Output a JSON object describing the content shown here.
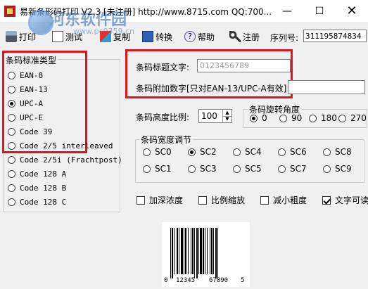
{
  "window": {
    "title": "易新条形码打印 V2.3 [未注册]  http://www.8715.com QQ:700..."
  },
  "watermark": {
    "title": "河东软件园",
    "url": "www.pc0359.cn"
  },
  "toolbar": {
    "print": "打印",
    "test": "测试",
    "copy": "复制",
    "convert": "转换",
    "help": "帮助",
    "register": "注册",
    "serial_label": "序列号:",
    "serial_value": "311195874834"
  },
  "standard_group": {
    "legend": "条码标准类型",
    "options": [
      "EAN-8",
      "EAN-13",
      "UPC-A",
      "UPC-E",
      "Code 39",
      "Code 2/5 interleaved",
      "Code 2/5i (Frachtpost)",
      "Code 128 A",
      "Code 128 B",
      "Code 128 C"
    ],
    "selected": "UPC-A"
  },
  "text_fields": {
    "title_label": "条码标题文字:",
    "title_value": "0123456789",
    "addon_label": "条码附加数字[只对EAN-13/UPC-A有效]:",
    "addon_value": ""
  },
  "height": {
    "label": "条码高度比例:",
    "value": "100"
  },
  "rotation": {
    "legend": "条码旋转角度",
    "options": [
      "0",
      "90",
      "180",
      "270"
    ],
    "selected": "0"
  },
  "width_group": {
    "legend": "条码宽度调节",
    "row1": [
      "SC0",
      "SC2",
      "SC4",
      "SC6",
      "SC8"
    ],
    "row2": [
      "SC1",
      "SC3",
      "SC5",
      "SC7",
      "SC9"
    ],
    "selected": "SC2"
  },
  "options": {
    "darken": "加深浓度",
    "scale": "比例缩放",
    "reduce": "减小粗度",
    "text_readable": "文字可读"
  },
  "barcode": {
    "digits": [
      "0",
      "12345",
      "67890",
      "5"
    ]
  },
  "colors": {
    "highlight": "#e0141e"
  }
}
